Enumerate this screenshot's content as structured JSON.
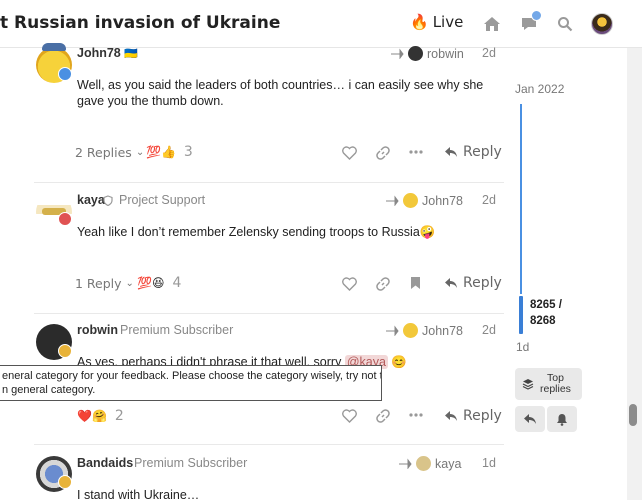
{
  "header": {
    "title": "t Russian invasion of Ukraine",
    "live_label": "Live",
    "icons": [
      "fire-icon",
      "home-icon",
      "chat-icon",
      "search-icon",
      "user-avatar"
    ]
  },
  "posts": [
    {
      "username": "John78",
      "flag": "🇺🇦",
      "user_title": "",
      "reply_to": "robwin",
      "age": "2d",
      "body": "Well, as you said the leaders of both countries… i can easily see why she gave you the thumb down.",
      "replies_label": "2 Replies",
      "reactions": "💯👍",
      "reaction_count": "3",
      "reply_label": "Reply"
    },
    {
      "username": "kaya",
      "user_title": "Project Support",
      "reply_to": "John78",
      "age": "2d",
      "body": "Yeah like I don’t remember Zelensky sending troops to Russia🤪",
      "replies_label": "1 Reply",
      "reactions": "💯😆",
      "reaction_count": "4",
      "reply_label": "Reply"
    },
    {
      "username": "robwin",
      "user_title": "Premium Subscriber",
      "reply_to": "John78",
      "age": "2d",
      "body_prefix": "As yes, perhaps i didn't phrase it that well, sorry",
      "mention": "@kaya",
      "body_suffix": "😊",
      "reactions": "❤️🤗",
      "reaction_count": "2",
      "reply_label": "Reply"
    },
    {
      "username": "Bandaids",
      "user_title": "Premium Subscriber",
      "reply_to": "kaya",
      "age": "1d",
      "body": "I stand with Ukraine…"
    }
  ],
  "tooltip": {
    "line1": "eneral category for your feedback. Please choose the category wisely, try not to post",
    "line2": "n general category."
  },
  "timeline": {
    "start_date": "Jan 2022",
    "position_current": "8265 /",
    "position_total": "8268",
    "end_age": "1d",
    "top_replies_line1": "Top",
    "top_replies_line2": "replies",
    "progress_fraction": 0.9996
  },
  "colors": {
    "accent": "#4a90e2",
    "mention_bg": "#f2d7d7",
    "heart": "#e45735"
  }
}
